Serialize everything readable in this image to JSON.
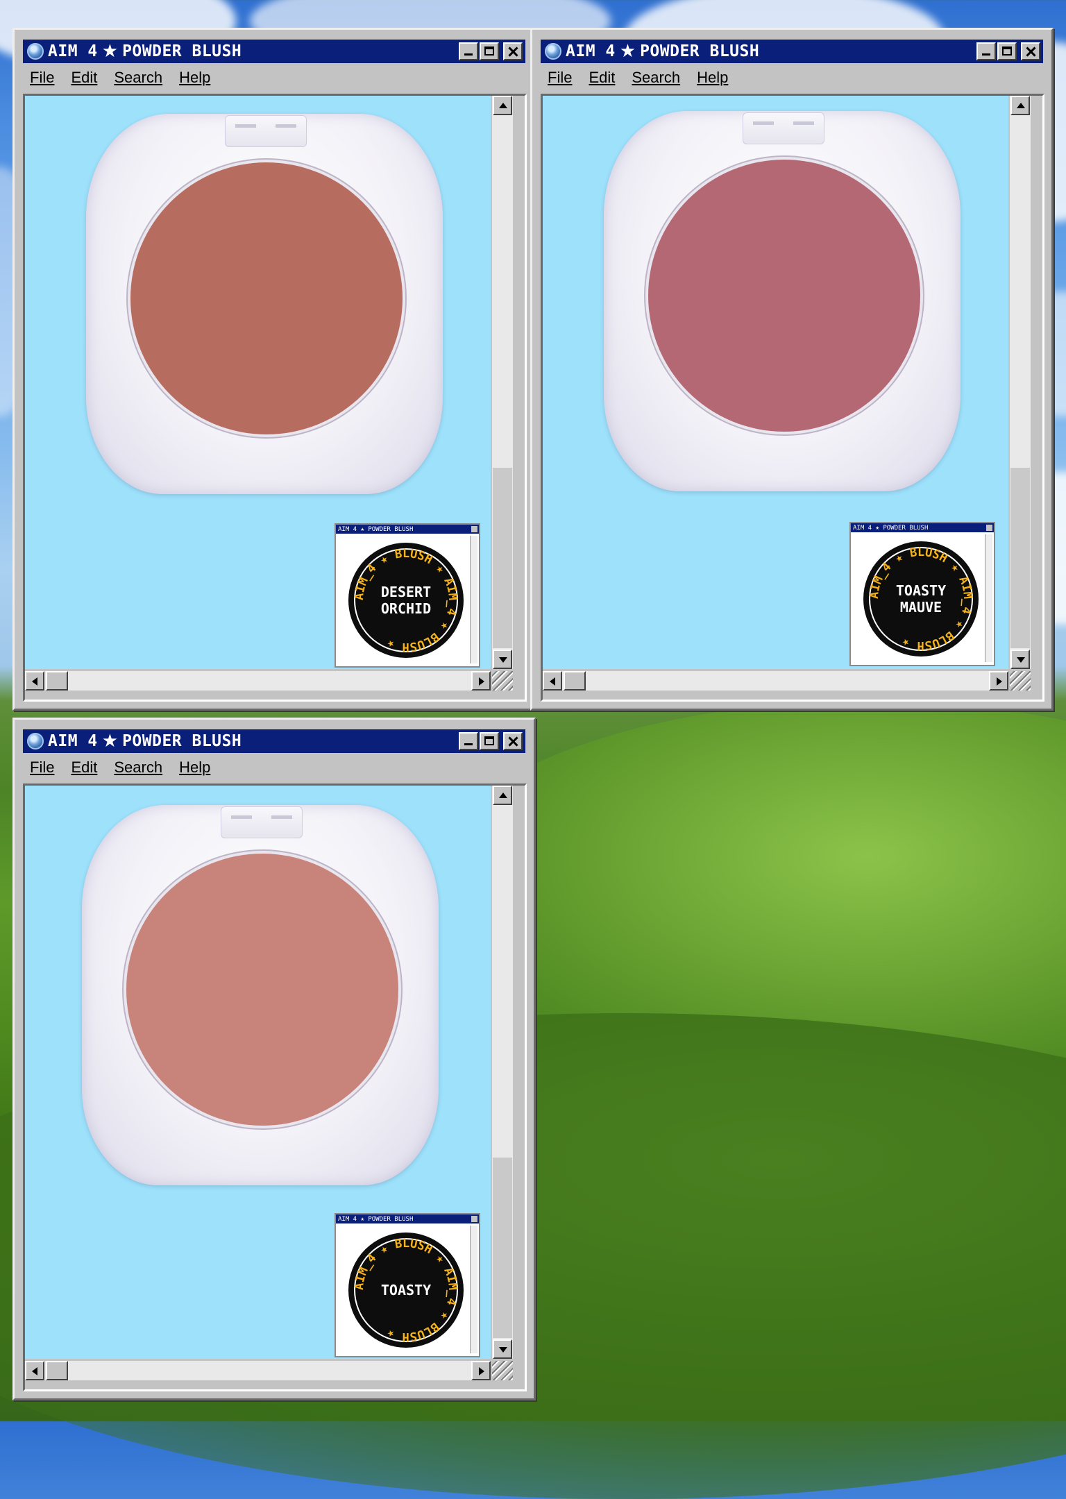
{
  "colors": {
    "titlebar": "#0a1f7a",
    "window_face": "#c3c3c3",
    "viewport_bg": "#9de1fb",
    "badge_fill": "#0d0d0d",
    "badge_text_gold": "#f5b21a"
  },
  "windows": [
    {
      "title": "AIM 4",
      "title_suffix": "POWDER BLUSH",
      "menu": [
        "File",
        "Edit",
        "Search",
        "Help"
      ],
      "shade_color": "#b66c5e",
      "shade_color_edge": "#9c5548",
      "mini_title": "AIM 4 ★ POWDER BLUSH",
      "badge_ring_text": "AIM_4 ★ BLUSH ★ AIM_4 ★ BLUSH ★",
      "shade_line1": "DESERT",
      "shade_line2": "ORCHID"
    },
    {
      "title": "AIM 4",
      "title_suffix": "POWDER BLUSH",
      "menu": [
        "File",
        "Edit",
        "Search",
        "Help"
      ],
      "shade_color": "#b36874",
      "shade_color_edge": "#93505c",
      "mini_title": "AIM 4 ★ POWDER BLUSH",
      "badge_ring_text": "AIM_4 ★ BLUSH ★ AIM_4 ★ BLUSH ★",
      "shade_line1": "TOASTY",
      "shade_line2": "MAUVE"
    },
    {
      "title": "AIM 4",
      "title_suffix": "POWDER BLUSH",
      "menu": [
        "File",
        "Edit",
        "Search",
        "Help"
      ],
      "shade_color": "#c8837a",
      "shade_color_edge": "#ad6b62",
      "mini_title": "AIM 4 ★ POWDER BLUSH",
      "badge_ring_text": "AIM_4 ★ BLUSH ★ AIM_4 ★ BLUSH ★",
      "shade_line1": "TOASTY",
      "shade_line2": ""
    }
  ]
}
